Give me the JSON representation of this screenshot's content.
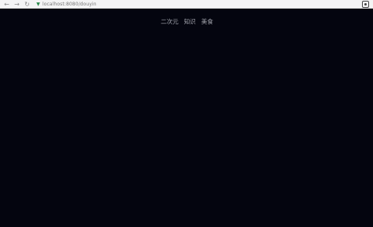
{
  "browser": {
    "url": "localhost:8080/douyin",
    "back_icon": "arrow-left-icon",
    "forward_icon": "arrow-right-icon",
    "reload_icon": "reload-icon",
    "secure_icon": "shield-icon",
    "extension_icon": "extension-icon"
  },
  "nav": {
    "items": [
      {
        "label": "二次元"
      },
      {
        "label": "知识"
      },
      {
        "label": "美食"
      }
    ]
  },
  "colors": {
    "page_background": "#04050f",
    "nav_text": "#a7a9b2",
    "toolbar_background": "#f4f4f4"
  }
}
